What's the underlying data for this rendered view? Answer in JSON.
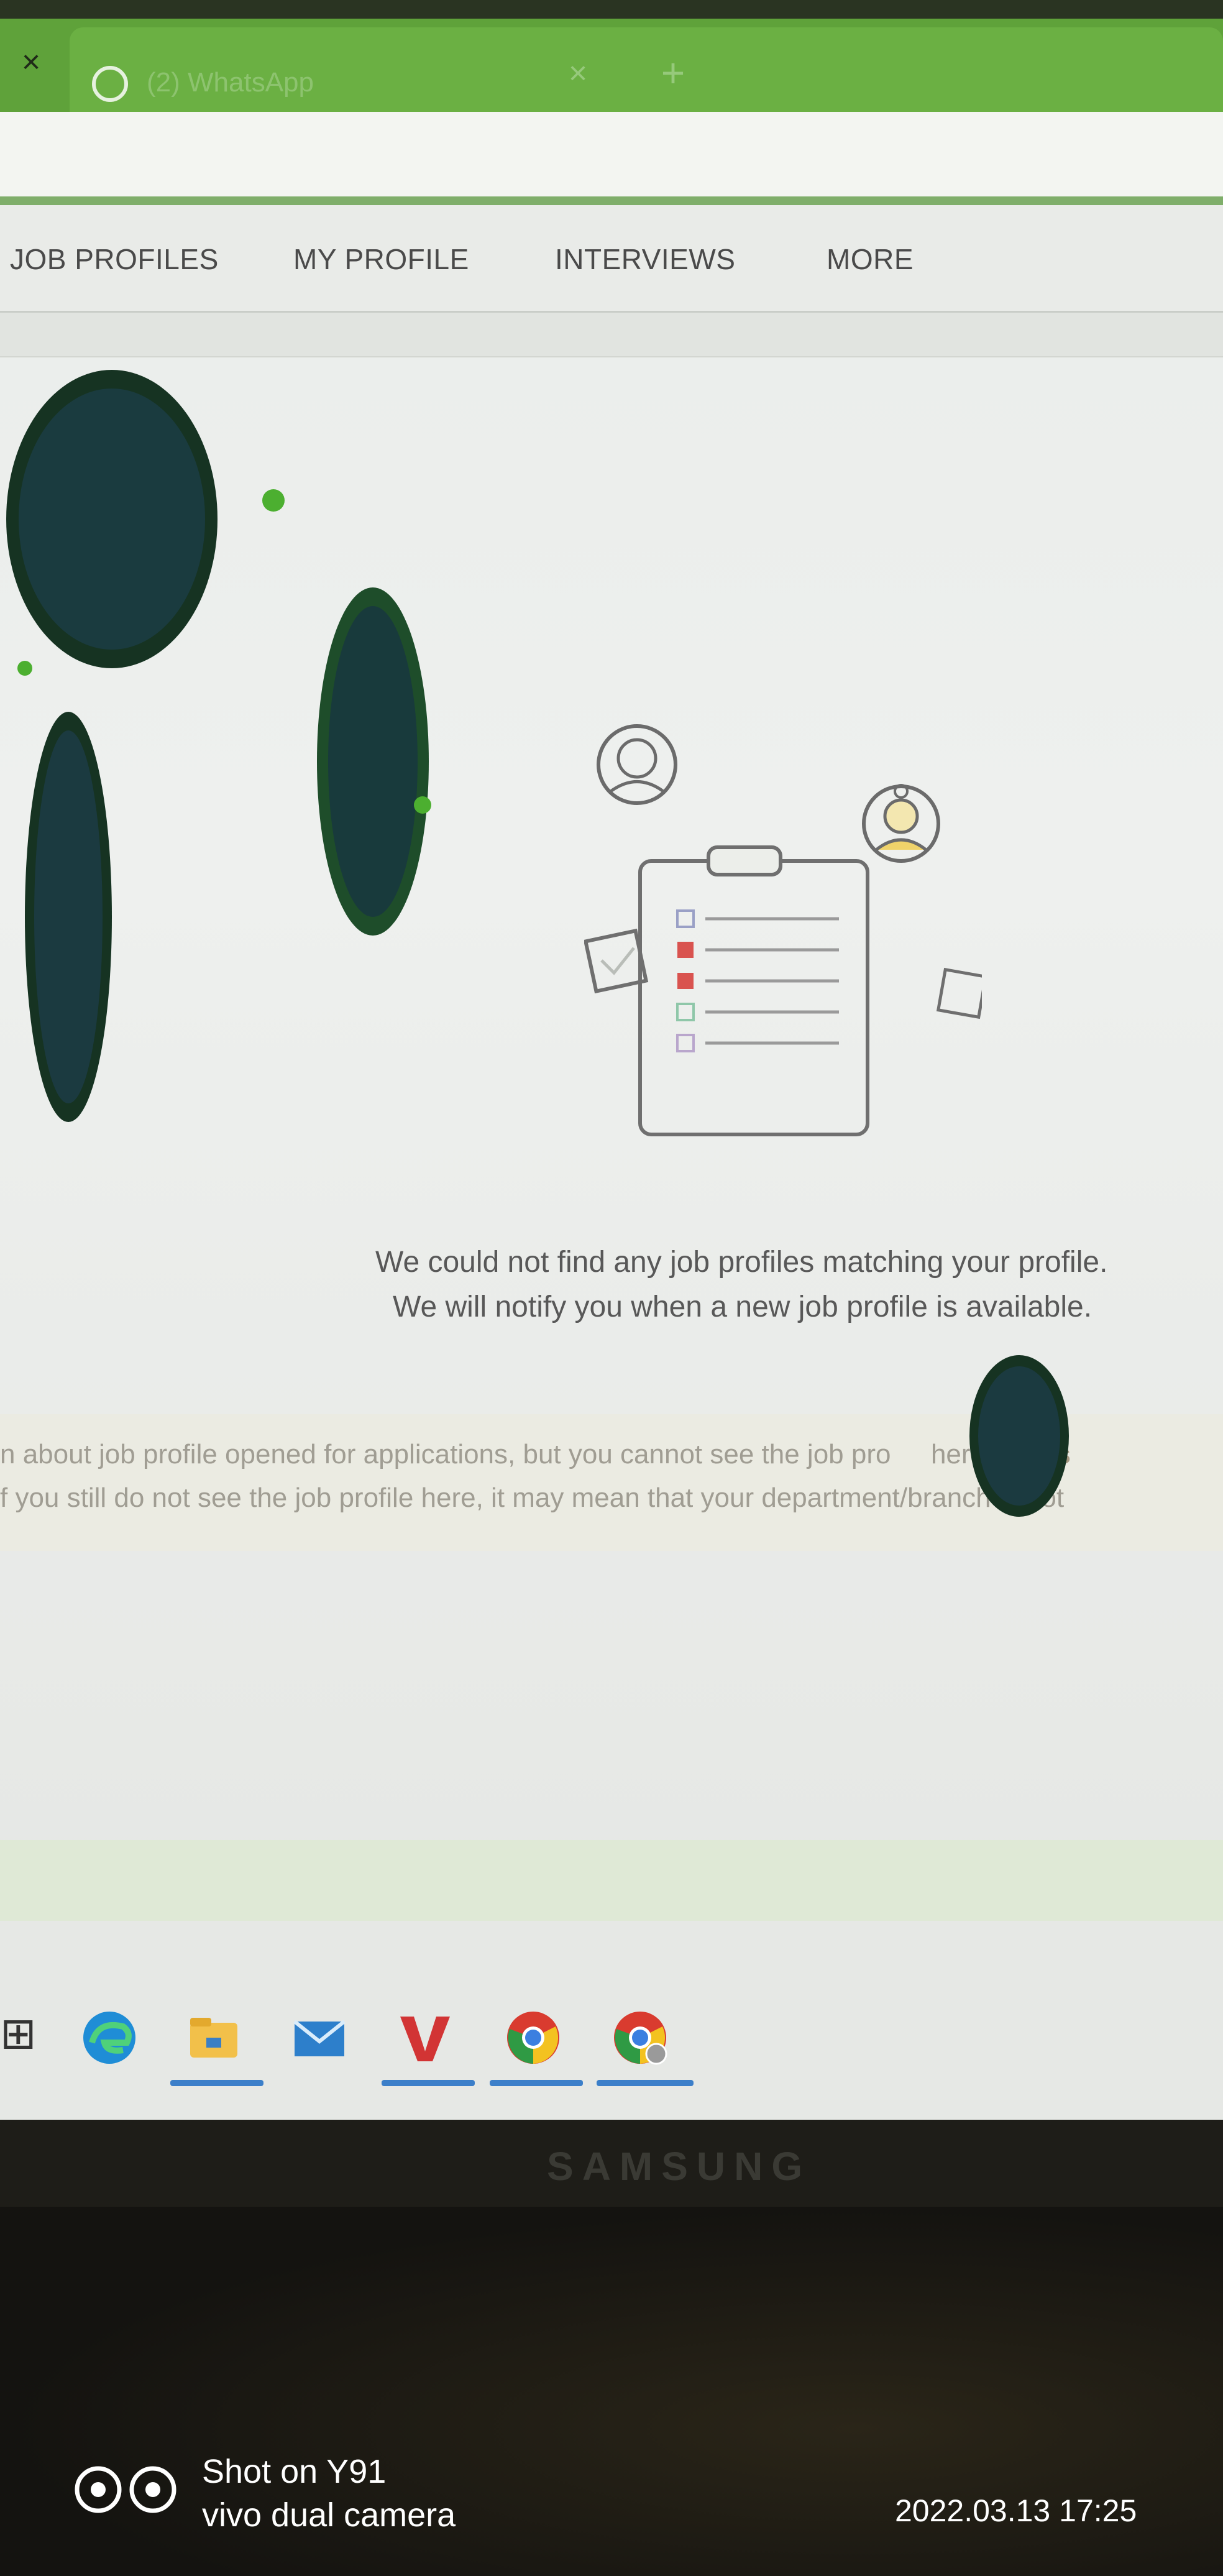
{
  "browser": {
    "prev_tab_close_glyph": "×",
    "active_tab": {
      "title": "(2) WhatsApp",
      "close_glyph": "×"
    },
    "new_tab_glyph": "+"
  },
  "nav": {
    "items": [
      {
        "label": "JOB PROFILES"
      },
      {
        "label": "MY PROFILE"
      },
      {
        "label": "INTERVIEWS"
      },
      {
        "label": "MORE"
      }
    ]
  },
  "empty_state": {
    "line1": "We could not find any job profiles matching your profile.",
    "line2": "We will notify you when a new job profile is available."
  },
  "note": {
    "line1_text": "n about job profile opened for applications, but you cannot see the job pro",
    "line1_tail": "here, ",
    "line1_bold": "pleas",
    "line2": "f you still do not see the job profile here, it may mean that your department/branch is not"
  },
  "taskbar": {
    "search_glyph": "⊞",
    "icons": [
      "edge-icon",
      "file-explorer-icon",
      "mail-icon",
      "wps-office-icon",
      "chrome-icon",
      "chrome-profile-icon"
    ]
  },
  "monitor": {
    "brand": "SAMSUNG"
  },
  "watermark": {
    "line1": "Shot on Y91",
    "line2": "vivo dual camera",
    "date": "2022.03.13 17:25"
  },
  "colors": {
    "tab_green": "#5fa23a",
    "accent_red": "#d9534f",
    "illus_yellow": "#f0d36a"
  }
}
